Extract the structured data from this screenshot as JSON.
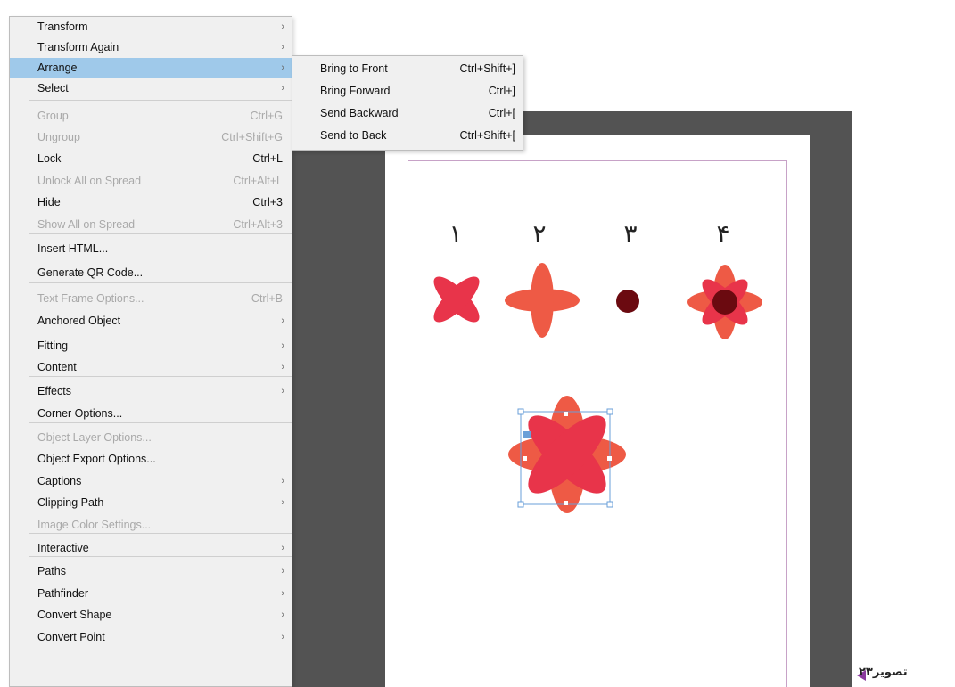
{
  "menu": {
    "items": [
      {
        "label": "Transform",
        "shortcut": "",
        "submenu": true,
        "disabled": false
      },
      {
        "label": "Transform Again",
        "shortcut": "",
        "submenu": true,
        "disabled": false
      },
      {
        "label": "Arrange",
        "shortcut": "",
        "submenu": true,
        "disabled": false,
        "highlighted": true
      },
      {
        "label": "Select",
        "shortcut": "",
        "submenu": true,
        "disabled": false
      },
      {
        "label": "Group",
        "shortcut": "Ctrl+G",
        "submenu": false,
        "disabled": true
      },
      {
        "label": "Ungroup",
        "shortcut": "Ctrl+Shift+G",
        "submenu": false,
        "disabled": true
      },
      {
        "label": "Lock",
        "shortcut": "Ctrl+L",
        "submenu": false,
        "disabled": false
      },
      {
        "label": "Unlock All on Spread",
        "shortcut": "Ctrl+Alt+L",
        "submenu": false,
        "disabled": true
      },
      {
        "label": "Hide",
        "shortcut": "Ctrl+3",
        "submenu": false,
        "disabled": false
      },
      {
        "label": "Show All on Spread",
        "shortcut": "Ctrl+Alt+3",
        "submenu": false,
        "disabled": true
      },
      {
        "label": "Insert HTML...",
        "shortcut": "",
        "submenu": false,
        "disabled": false
      },
      {
        "label": "Generate QR Code...",
        "shortcut": "",
        "submenu": false,
        "disabled": false
      },
      {
        "label": "Text Frame Options...",
        "shortcut": "Ctrl+B",
        "submenu": false,
        "disabled": true
      },
      {
        "label": "Anchored Object",
        "shortcut": "",
        "submenu": true,
        "disabled": false
      },
      {
        "label": "Fitting",
        "shortcut": "",
        "submenu": true,
        "disabled": false
      },
      {
        "label": "Content",
        "shortcut": "",
        "submenu": true,
        "disabled": false
      },
      {
        "label": "Effects",
        "shortcut": "",
        "submenu": true,
        "disabled": false
      },
      {
        "label": "Corner Options...",
        "shortcut": "",
        "submenu": false,
        "disabled": false
      },
      {
        "label": "Object Layer Options...",
        "shortcut": "",
        "submenu": false,
        "disabled": true
      },
      {
        "label": "Object Export Options...",
        "shortcut": "",
        "submenu": false,
        "disabled": false
      },
      {
        "label": "Captions",
        "shortcut": "",
        "submenu": true,
        "disabled": false
      },
      {
        "label": "Clipping Path",
        "shortcut": "",
        "submenu": true,
        "disabled": false
      },
      {
        "label": "Image Color Settings...",
        "shortcut": "",
        "submenu": false,
        "disabled": true
      },
      {
        "label": "Interactive",
        "shortcut": "",
        "submenu": true,
        "disabled": false
      },
      {
        "label": "Paths",
        "shortcut": "",
        "submenu": true,
        "disabled": false
      },
      {
        "label": "Pathfinder",
        "shortcut": "",
        "submenu": true,
        "disabled": false
      },
      {
        "label": "Convert Shape",
        "shortcut": "",
        "submenu": true,
        "disabled": false
      },
      {
        "label": "Convert Point",
        "shortcut": "",
        "submenu": true,
        "disabled": false
      }
    ],
    "chevron": "›"
  },
  "submenu": {
    "items": [
      {
        "label": "Bring to Front",
        "shortcut": "Ctrl+Shift+]"
      },
      {
        "label": "Bring Forward",
        "shortcut": "Ctrl+]"
      },
      {
        "label": "Send Backward",
        "shortcut": "Ctrl+["
      },
      {
        "label": "Send to Back",
        "shortcut": "Ctrl+Shift+["
      }
    ]
  },
  "canvas": {
    "numbers": [
      "١",
      "٢",
      "٣",
      "۴"
    ],
    "colors": {
      "red": "#e8344a",
      "orange": "#ee5a45",
      "dark": "#6b0a10",
      "pasteboard": "#535353",
      "highlight": "#9fc9ea",
      "selection": "#6a9fd8"
    }
  },
  "caption": {
    "text": "تصویر۲۳"
  }
}
